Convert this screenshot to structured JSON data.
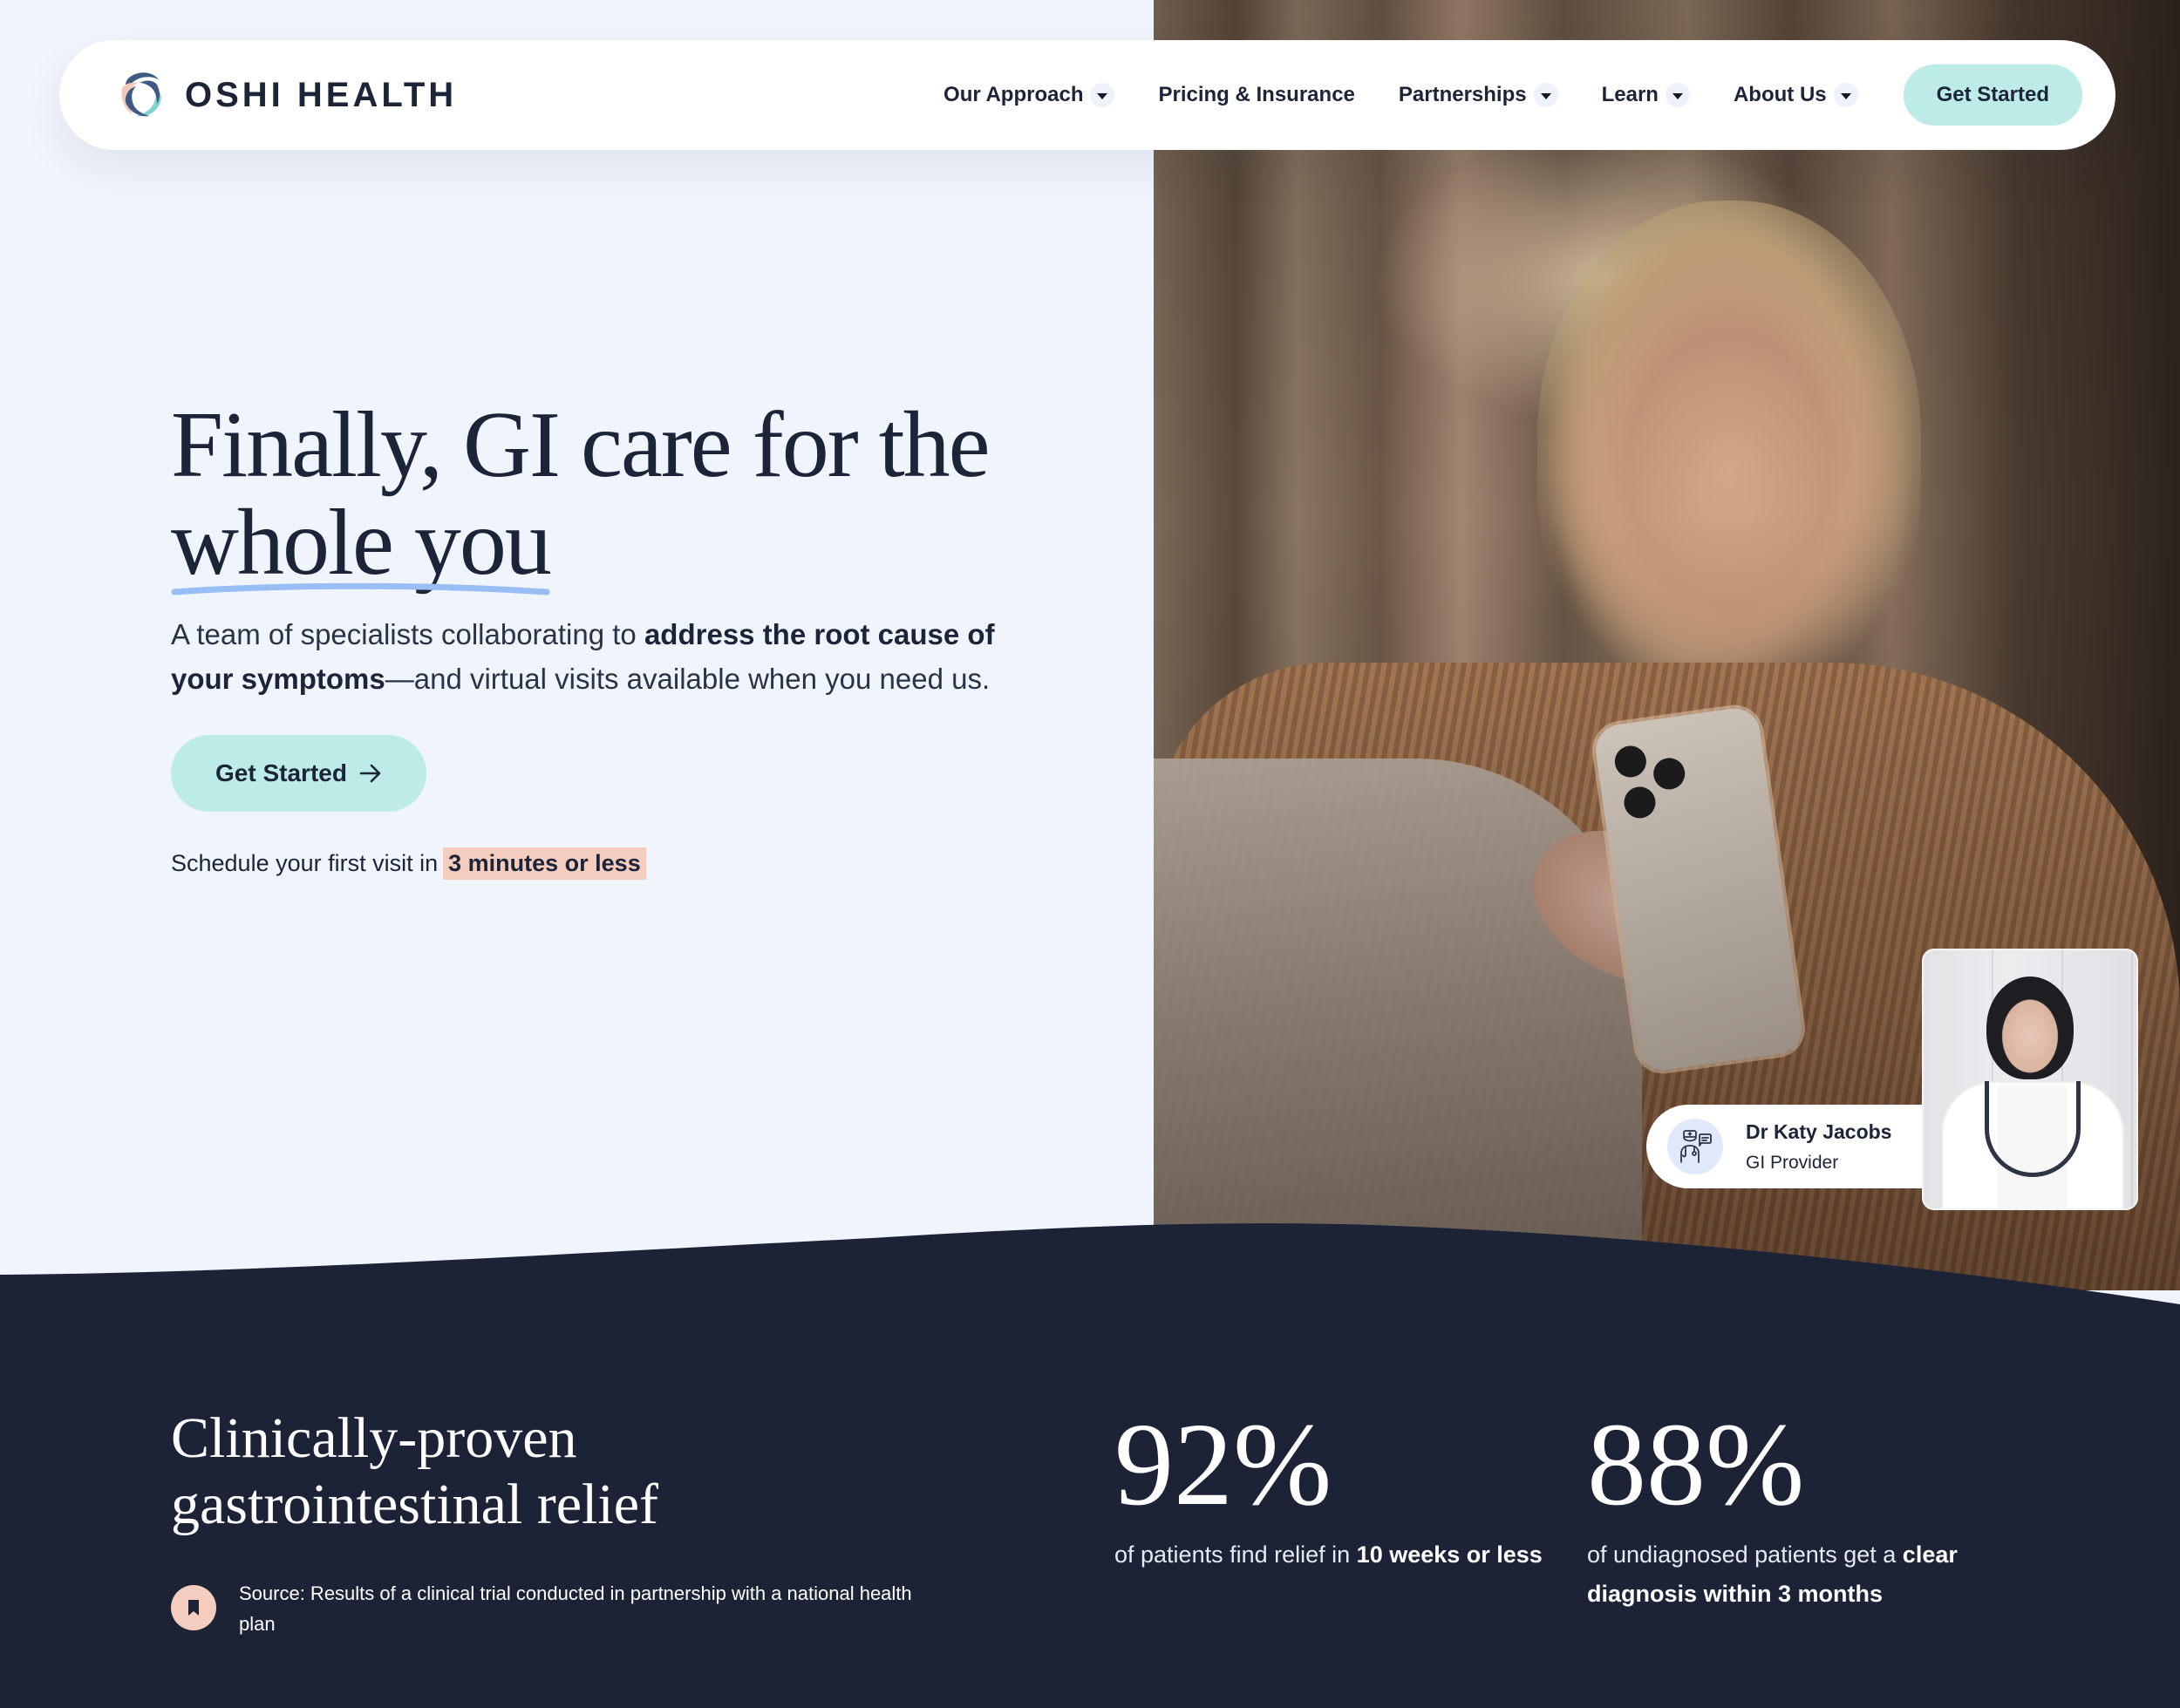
{
  "brand": {
    "name": "OSHI HEALTH",
    "colors": {
      "navy": "#1c2337",
      "text": "#1c2438",
      "mint": "#bdebe8",
      "peach": "#f5cdbf",
      "hero_bg": "#f0f4fc",
      "underline": "#99bdf5",
      "logo_peach": "#f2c9b8",
      "logo_blue": "#3f5a80",
      "logo_teal": "#7fd3cf"
    }
  },
  "nav": {
    "items": [
      {
        "label": "Our Approach",
        "has_dropdown": true,
        "icon": "caret-down-icon"
      },
      {
        "label": "Pricing & Insurance",
        "has_dropdown": false
      },
      {
        "label": "Partnerships",
        "has_dropdown": true,
        "icon": "caret-down-icon"
      },
      {
        "label": "Learn",
        "has_dropdown": true,
        "icon": "caret-down-icon"
      },
      {
        "label": "About Us",
        "has_dropdown": true,
        "icon": "caret-down-icon"
      }
    ],
    "cta_label": "Get Started"
  },
  "hero": {
    "title_line1": "Finally, GI care for the",
    "title_line2": "whole you",
    "subtitle_pre": "A team of specialists collaborating to ",
    "subtitle_bold": "address the root cause of your symptoms",
    "subtitle_post": "—and virtual visits available when you need us.",
    "cta_label": "Get Started",
    "cta_icon": "arrow-right-icon",
    "schedule_pre": "Schedule your first visit in",
    "schedule_highlight": "3 minutes or less"
  },
  "provider_card": {
    "name": "Dr Katy Jacobs",
    "role": "GI Provider",
    "icon": "doctor-chat-icon"
  },
  "stats_section": {
    "title_line1": "Clinically-proven",
    "title_line2": "gastrointestinal relief",
    "source_icon": "bookmark-icon",
    "source_text": "Source: Results of a clinical trial conducted in partnership with a national health plan",
    "stats": [
      {
        "value": "92%",
        "desc_pre": "of patients find relief in ",
        "desc_bold": "10 weeks or less"
      },
      {
        "value": "88%",
        "desc_pre": "of undiagnosed patients get a ",
        "desc_bold": "clear diagnosis within 3 months"
      }
    ]
  }
}
